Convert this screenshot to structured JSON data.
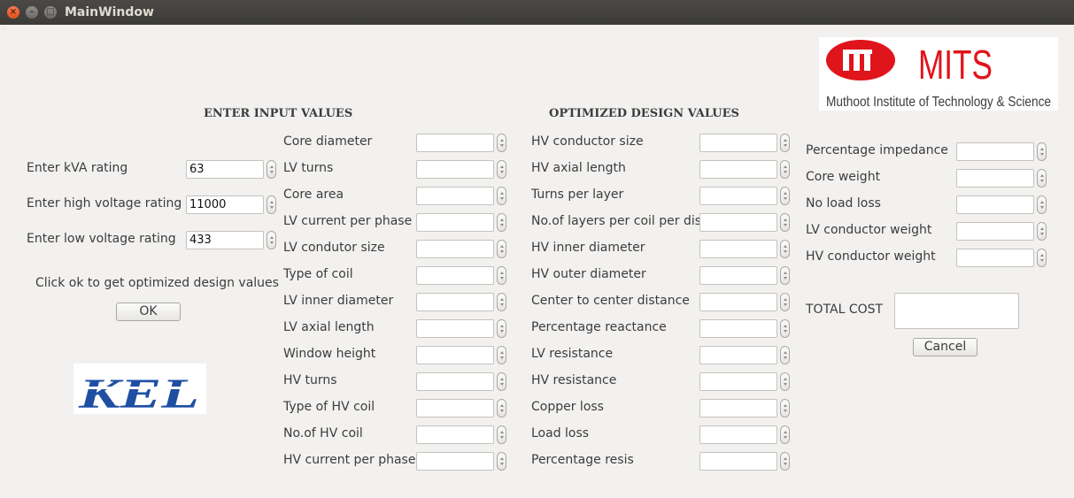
{
  "window": {
    "title": "MainWindow"
  },
  "titlebar_icons": {
    "close": "×",
    "minimize": "–",
    "maximize": "□"
  },
  "input_section": {
    "title": "ENTER INPUT VALUES",
    "fields": [
      {
        "label": "Enter kVA rating",
        "value": "63"
      },
      {
        "label": "Enter high voltage rating",
        "value": "11000"
      },
      {
        "label": "Enter low voltage rating",
        "value": "433"
      }
    ],
    "hint": "Click ok to get optimized design values",
    "ok_label": "OK"
  },
  "design_section": {
    "title": "OPTIMIZED DESIGN VALUES",
    "column1": [
      {
        "label": "Core diameter",
        "value": ""
      },
      {
        "label": "LV turns",
        "value": ""
      },
      {
        "label": "Core area",
        "value": ""
      },
      {
        "label": "LV current per phase",
        "value": ""
      },
      {
        "label": "LV condutor size",
        "value": ""
      },
      {
        "label": "Type of coil",
        "value": ""
      },
      {
        "label": "LV inner diameter",
        "value": ""
      },
      {
        "label": "LV axial length",
        "value": ""
      },
      {
        "label": "Window height",
        "value": ""
      },
      {
        "label": "HV turns",
        "value": ""
      },
      {
        "label": "Type of HV coil",
        "value": ""
      },
      {
        "label": "No.of HV coil",
        "value": ""
      },
      {
        "label": "HV current per phase",
        "value": ""
      }
    ],
    "column2": [
      {
        "label": "HV conductor size",
        "value": ""
      },
      {
        "label": "HV axial length",
        "value": ""
      },
      {
        "label": "Turns per layer",
        "value": ""
      },
      {
        "label": "No.of layers per coil per disc",
        "value": ""
      },
      {
        "label": "HV inner diameter",
        "value": ""
      },
      {
        "label": "HV outer diameter",
        "value": ""
      },
      {
        "label": "Center to center distance",
        "value": ""
      },
      {
        "label": "Percentage reactance",
        "value": ""
      },
      {
        "label": "LV resistance",
        "value": ""
      },
      {
        "label": "HV resistance",
        "value": ""
      },
      {
        "label": "Copper loss",
        "value": ""
      },
      {
        "label": "Load loss",
        "value": ""
      },
      {
        "label": "Percentage resis",
        "value": ""
      }
    ],
    "column3": [
      {
        "label": "Percentage impedance",
        "value": ""
      },
      {
        "label": "Core weight",
        "value": ""
      },
      {
        "label": "No load loss",
        "value": ""
      },
      {
        "label": "LV conductor weight",
        "value": ""
      },
      {
        "label": "HV conductor weight",
        "value": ""
      }
    ]
  },
  "total_cost": {
    "label": "TOTAL COST",
    "value": ""
  },
  "cancel_label": "Cancel",
  "logos": {
    "mits": {
      "name": "MITS",
      "tagline": "Muthoot Institute of Technology & Science",
      "color": "#e0141b"
    },
    "kel": {
      "name": "KEL",
      "color": "#1e4fa3"
    }
  }
}
